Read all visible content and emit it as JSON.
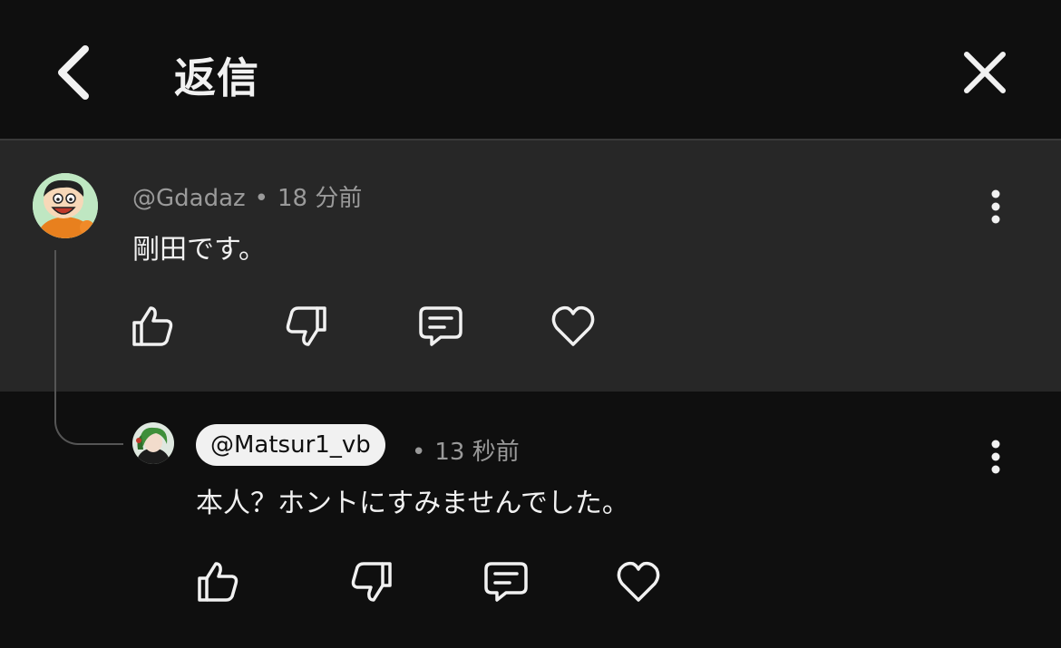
{
  "header": {
    "title": "返信",
    "back_icon": "chevron-left-icon",
    "close_icon": "close-icon"
  },
  "comment": {
    "author": "@Gdadaz",
    "separator": "•",
    "time": "18 分前",
    "text": "剛田です。",
    "more_icon": "more-vert-icon",
    "actions": [
      "thumb-up-icon",
      "thumb-down-icon",
      "reply-icon",
      "heart-icon"
    ]
  },
  "reply": {
    "mention": "@Matsur1_vb",
    "separator": "•",
    "time": "13 秒前",
    "text": "本人？ホントにすみませんでした。",
    "more_icon": "more-vert-icon",
    "actions": [
      "thumb-up-icon",
      "thumb-down-icon",
      "reply-icon",
      "heart-icon"
    ]
  },
  "colors": {
    "background": "#0f0f0f",
    "highlight_background": "#272727",
    "text_primary": "#f1f1f1",
    "text_secondary": "#9a9a9a"
  }
}
